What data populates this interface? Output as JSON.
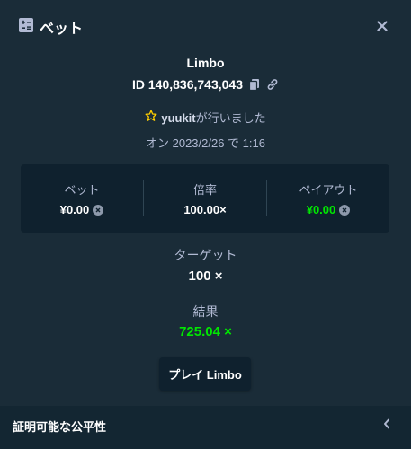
{
  "header": {
    "title": "ベット",
    "icon": "bet-slip-icon",
    "close_icon": "close-icon"
  },
  "bet": {
    "game": "Limbo",
    "id": "ID 140,836,743,043",
    "placed_by_user": "yuukit",
    "placed_by_suffix": "が行いました",
    "date": "オン 2023/2/26 で 1:16"
  },
  "stats": {
    "bet_label": "ベット",
    "bet_value": "¥0.00",
    "multiplier_label": "倍率",
    "multiplier_value": "100.00×",
    "payout_label": "ペイアウト",
    "payout_value": "¥0.00"
  },
  "target": {
    "label": "ターゲット",
    "value": "100 ×"
  },
  "result": {
    "label": "結果",
    "value": "725.04 ×"
  },
  "play_button": "プレイ Limbo",
  "footer": {
    "title": "証明可能な公平性"
  },
  "colors": {
    "background": "#1a2c38",
    "panel": "#0f212e",
    "muted_text": "#b1bad3",
    "accent_green": "#00e701",
    "star": "#ffce00"
  }
}
